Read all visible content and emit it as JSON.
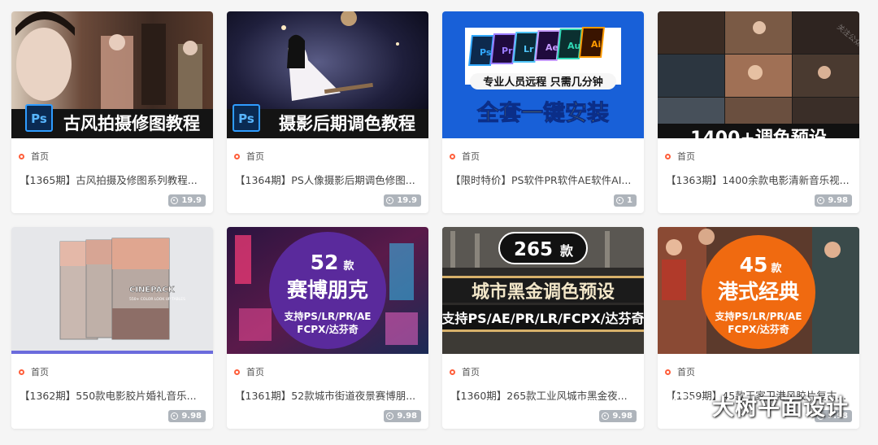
{
  "cards": [
    {
      "crumb": "首页",
      "title": "【1365期】古风拍摄及修图系列教程...",
      "price": "19.9",
      "thumb": {
        "badge": "Ps",
        "caption": "古风拍摄修图教程"
      }
    },
    {
      "crumb": "首页",
      "title": "【1364期】PS人像摄影后期调色修图...",
      "price": "19.9",
      "thumb": {
        "badge": "Ps",
        "caption": "摄影后期调色教程"
      }
    },
    {
      "crumb": "首页",
      "title": "【限时特价】PS软件PR软件AE软件AI...",
      "price": "1",
      "thumb": {
        "apps": [
          "Ps",
          "Pr",
          "Lr",
          "Ae",
          "Au",
          "Ai"
        ],
        "subtitle": "专业人员远程 只需几分钟",
        "caption": "全套一键安装"
      }
    },
    {
      "crumb": "首页",
      "title": "【1363期】1400余款电影清新音乐视...",
      "price": "9.98",
      "thumb": {
        "caption": "1400+调色预设",
        "watermark": "关注公众号 · 图雅专"
      }
    },
    {
      "crumb": "首页",
      "title": "【1362期】550款电影胶片婚礼音乐...",
      "price": "9.98",
      "thumb": {
        "box_title": "CINEPACK",
        "box_sub": "550+ COLOR LOOK UP TABLES"
      }
    },
    {
      "crumb": "首页",
      "title": "【1361期】52款城市街道夜景赛博朋...",
      "price": "9.98",
      "thumb": {
        "count": "52",
        "unit": "款",
        "caption": "赛博朋克",
        "support1": "支持PS/LR/PR/AE",
        "support2": "FCPX/达芬奇"
      }
    },
    {
      "crumb": "首页",
      "title": "【1360期】265款工业风城市黑金夜...",
      "price": "9.98",
      "thumb": {
        "count": "265",
        "unit": "款",
        "caption": "城市黑金调色预设",
        "support1": "支持PS/AE/PR/LR/FCPX/达芬奇"
      }
    },
    {
      "crumb": "首页",
      "title": "【1359期】45款王家卫港风胶片复古...",
      "price": "9.98",
      "thumb": {
        "count": "45",
        "unit": "款",
        "caption": "港式经典",
        "support1": "支持PS/LR/PR/AE",
        "support2": "FCPX/达芬奇"
      }
    }
  ],
  "watermark": {
    "text": "大树平面设计"
  }
}
